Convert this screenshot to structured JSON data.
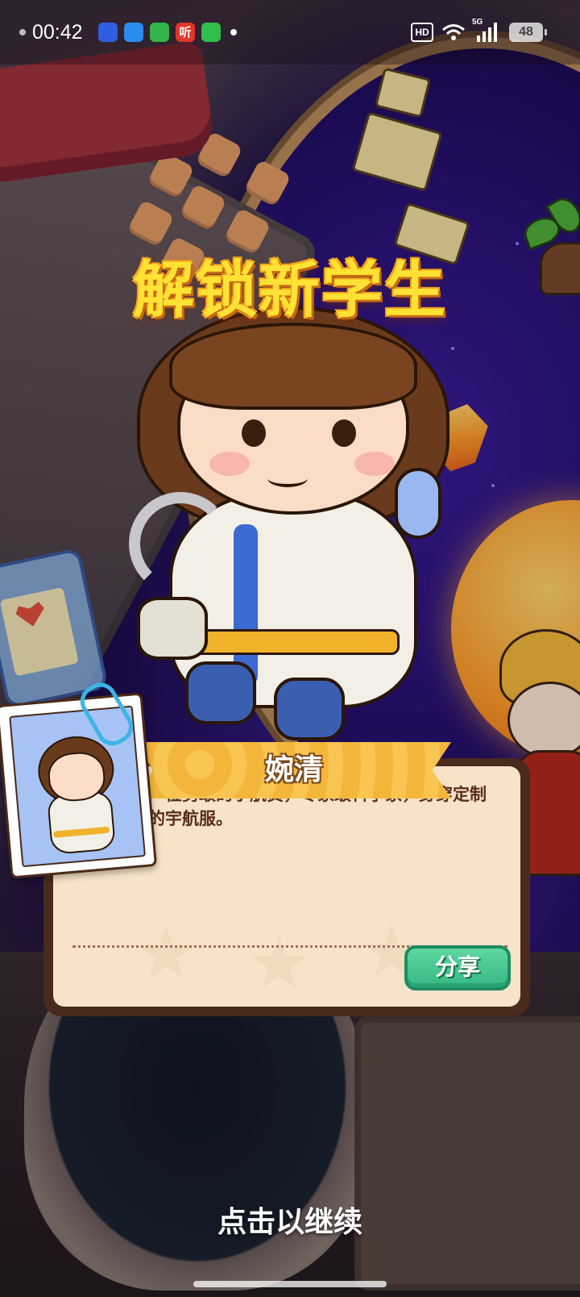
{
  "status_bar": {
    "time": "00:42",
    "apps": [
      {
        "icon": "baidu-icon",
        "glyph": "",
        "color": "#2f5fe0"
      },
      {
        "icon": "browser-icon",
        "glyph": "",
        "color": "#2a8cf0"
      },
      {
        "icon": "shopping-icon",
        "glyph": "",
        "color": "#33b54a"
      },
      {
        "icon": "listen-app-icon",
        "glyph": "听",
        "color": "#e2352a"
      },
      {
        "icon": "message-icon",
        "glyph": "",
        "color": "#2fbf4a"
      }
    ],
    "hd_label": "HD",
    "network_label": "5G",
    "battery": "48"
  },
  "banner": {
    "title": "解锁新学生"
  },
  "student": {
    "name": "婉清",
    "description": "一位勇敢的宇航员，专家级科学家，身穿定制的宇航服。"
  },
  "actions": {
    "share_label": "分享",
    "continue_hint": "点击以继续"
  },
  "colors": {
    "title": "#ffe234",
    "ribbon": "#f4b63a",
    "card_bg": "#f6e3c8",
    "card_border": "#4a2a1c",
    "share_button": "#35b982"
  }
}
